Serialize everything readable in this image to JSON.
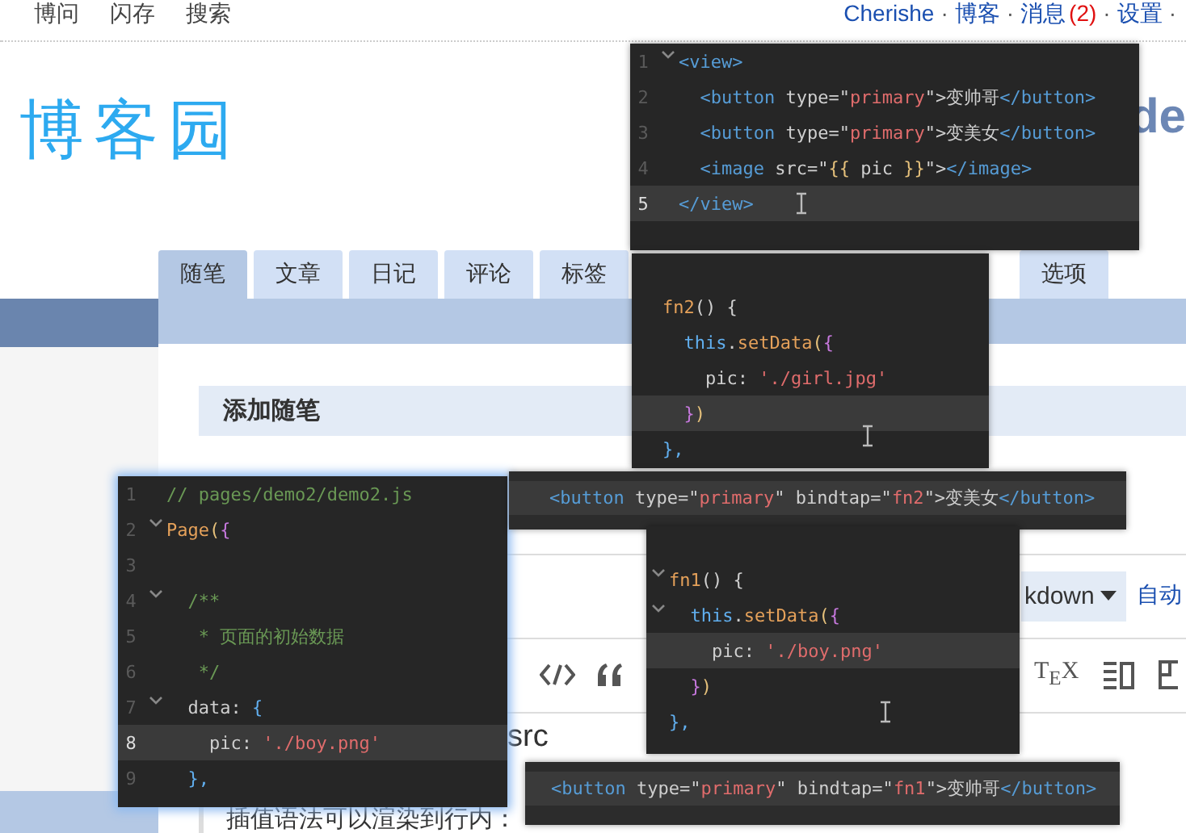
{
  "top_nav": {
    "left_links": [
      "博问",
      "闪存",
      "搜索"
    ],
    "right_items": [
      {
        "kind": "link",
        "text": "Cherishe"
      },
      {
        "kind": "sep",
        "text": "·"
      },
      {
        "kind": "link",
        "text": "博客"
      },
      {
        "kind": "sep",
        "text": "·"
      },
      {
        "kind": "link",
        "text": "消息"
      },
      {
        "kind": "count",
        "text": "(2)"
      },
      {
        "kind": "sep",
        "text": "·"
      },
      {
        "kind": "link",
        "text": "设置"
      },
      {
        "kind": "sep",
        "text": "·"
      }
    ]
  },
  "logo": "博客园",
  "blog_title_fragment": "de",
  "tabs": [
    {
      "label": "随笔",
      "selected": true
    },
    {
      "label": "文章",
      "selected": false
    },
    {
      "label": "日记",
      "selected": false
    },
    {
      "label": "评论",
      "selected": false
    },
    {
      "label": "标签",
      "selected": false
    },
    {
      "label": "选项",
      "selected": false
    }
  ],
  "editor": {
    "heading": "添加随笔",
    "format_dropdown": "kdown",
    "autosave_link": "自动",
    "tex_button": "T$_{E}$X",
    "body_fragment": "src",
    "quote_line": "插值语法可以渲染到行内："
  },
  "code_windows": [
    {
      "lines": [
        {
          "num": "1",
          "fold": true,
          "current": false,
          "tokens": [
            {
              "kind": "tag",
              "text": "<view>"
            }
          ]
        },
        {
          "num": "2",
          "fold": false,
          "current": false,
          "tokens": [
            {
              "kind": "tag",
              "text": "  <button"
            },
            {
              "kind": "plain",
              "text": " type=\""
            },
            {
              "kind": "str",
              "text": "primary"
            },
            {
              "kind": "plain",
              "text": "\">变帅哥"
            },
            {
              "kind": "tag",
              "text": "</button>"
            }
          ]
        },
        {
          "num": "3",
          "fold": false,
          "current": false,
          "tokens": [
            {
              "kind": "tag",
              "text": "  <button"
            },
            {
              "kind": "plain",
              "text": " type=\""
            },
            {
              "kind": "str",
              "text": "primary"
            },
            {
              "kind": "plain",
              "text": "\">变美女"
            },
            {
              "kind": "tag",
              "text": "</button>"
            }
          ]
        },
        {
          "num": "4",
          "fold": false,
          "current": false,
          "tokens": [
            {
              "kind": "tag",
              "text": "  <image"
            },
            {
              "kind": "plain",
              "text": " src=\""
            },
            {
              "kind": "brace",
              "text": "{{"
            },
            {
              "kind": "plain",
              "text": " pic "
            },
            {
              "kind": "brace",
              "text": "}}"
            },
            {
              "kind": "plain",
              "text": "\">"
            },
            {
              "kind": "tag",
              "text": "</image>"
            }
          ]
        },
        {
          "num": "5",
          "fold": false,
          "current": true,
          "tokens": [
            {
              "kind": "tag",
              "text": "</view>"
            }
          ]
        }
      ]
    },
    {
      "lines": [
        {
          "current": false
        },
        {
          "current": false,
          "tokens": [
            {
              "kind": "fn",
              "text": "fn2"
            },
            {
              "kind": "plain",
              "text": "() {"
            }
          ]
        },
        {
          "current": false,
          "tokens": [
            {
              "kind": "kw",
              "text": "  this"
            },
            {
              "kind": "plain",
              "text": "."
            },
            {
              "kind": "fn",
              "text": "setData"
            },
            {
              "kind": "brace",
              "text": "("
            },
            {
              "kind": "brace2",
              "text": "{"
            }
          ]
        },
        {
          "current": false,
          "tokens": [
            {
              "kind": "plain",
              "text": "    pic: "
            },
            {
              "kind": "str",
              "text": "'./girl.jpg'"
            }
          ]
        },
        {
          "current": true,
          "tokens": [
            {
              "kind": "brace2",
              "text": "  }"
            },
            {
              "kind": "brace",
              "text": ")"
            }
          ]
        },
        {
          "current": false,
          "tokens": [
            {
              "kind": "kw",
              "text": "},"
            }
          ]
        }
      ]
    },
    {
      "lines": [
        {
          "num": "1",
          "fold": false,
          "current": false,
          "tokens": [
            {
              "kind": "comment",
              "text": "// pages/demo2/demo2.js"
            }
          ]
        },
        {
          "num": "2",
          "fold": true,
          "current": false,
          "tokens": [
            {
              "kind": "fn",
              "text": "Page"
            },
            {
              "kind": "brace",
              "text": "("
            },
            {
              "kind": "brace2",
              "text": "{"
            }
          ]
        },
        {
          "num": "3",
          "fold": false,
          "current": false
        },
        {
          "num": "4",
          "fold": true,
          "current": false,
          "tokens": [
            {
              "kind": "comment",
              "text": "  /**"
            }
          ]
        },
        {
          "num": "5",
          "fold": false,
          "current": false,
          "tokens": [
            {
              "kind": "comment",
              "text": "   * 页面的初始数据"
            }
          ]
        },
        {
          "num": "6",
          "fold": false,
          "current": false,
          "tokens": [
            {
              "kind": "comment",
              "text": "   */"
            }
          ]
        },
        {
          "num": "7",
          "fold": true,
          "current": false,
          "tokens": [
            {
              "kind": "plain",
              "text": "  data: "
            },
            {
              "kind": "kw",
              "text": "{"
            }
          ]
        },
        {
          "num": "8",
          "fold": false,
          "current": true,
          "tokens": [
            {
              "kind": "plain",
              "text": "    pic: "
            },
            {
              "kind": "str",
              "text": "'./boy.png'"
            }
          ]
        },
        {
          "num": "9",
          "fold": false,
          "current": false,
          "tokens": [
            {
              "kind": "kw",
              "text": "  },"
            }
          ]
        }
      ]
    },
    {
      "lines": [
        {
          "current": true,
          "tokens": [
            {
              "kind": "tag",
              "text": "<button"
            },
            {
              "kind": "plain",
              "text": " type=\""
            },
            {
              "kind": "str",
              "text": "primary"
            },
            {
              "kind": "plain",
              "text": "\" bindtap=\""
            },
            {
              "kind": "str",
              "text": "fn2"
            },
            {
              "kind": "plain",
              "text": "\">变美女"
            },
            {
              "kind": "tag",
              "text": "</button>"
            }
          ]
        }
      ]
    },
    {
      "lines": [
        {
          "fold": false,
          "current": false
        },
        {
          "fold": true,
          "current": false,
          "tokens": [
            {
              "kind": "fn",
              "text": "fn1"
            },
            {
              "kind": "plain",
              "text": "() {"
            }
          ]
        },
        {
          "fold": true,
          "current": false,
          "tokens": [
            {
              "kind": "kw",
              "text": "  this"
            },
            {
              "kind": "plain",
              "text": "."
            },
            {
              "kind": "fn",
              "text": "setData"
            },
            {
              "kind": "brace",
              "text": "("
            },
            {
              "kind": "brace2",
              "text": "{"
            }
          ]
        },
        {
          "fold": false,
          "current": true,
          "tokens": [
            {
              "kind": "plain",
              "text": "    pic: "
            },
            {
              "kind": "str",
              "text": "'./boy.png'"
            }
          ]
        },
        {
          "fold": false,
          "current": false,
          "tokens": [
            {
              "kind": "brace2",
              "text": "  }"
            },
            {
              "kind": "brace",
              "text": ")"
            }
          ]
        },
        {
          "fold": false,
          "current": false,
          "tokens": [
            {
              "kind": "kw",
              "text": "},"
            }
          ]
        }
      ]
    },
    {
      "lines": [
        {
          "current": true,
          "tokens": [
            {
              "kind": "tag",
              "text": "<button"
            },
            {
              "kind": "plain",
              "text": " type=\""
            },
            {
              "kind": "str",
              "text": "primary"
            },
            {
              "kind": "plain",
              "text": "\" bindtap=\""
            },
            {
              "kind": "str",
              "text": "fn1"
            },
            {
              "kind": "plain",
              "text": "\">变帅哥"
            },
            {
              "kind": "tag",
              "text": "</button>"
            }
          ]
        }
      ]
    }
  ]
}
